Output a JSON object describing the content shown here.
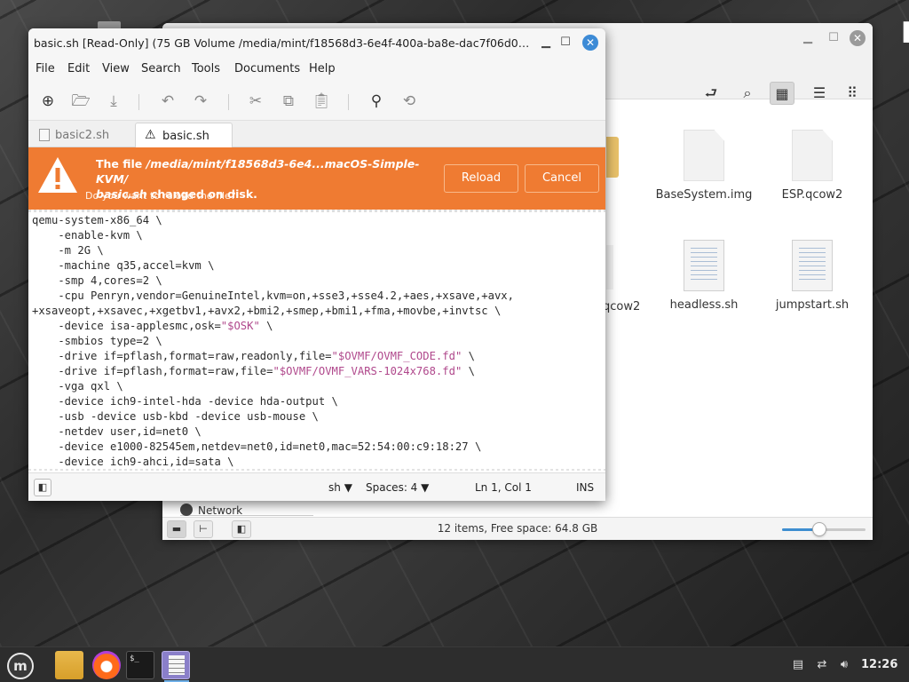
{
  "file_manager": {
    "files": [
      {
        "name": "BaseSystem.img",
        "kind": "blank"
      },
      {
        "name": "ESP.qcow2",
        "kind": "blank"
      },
      {
        "name": "headless.sh",
        "kind": "script"
      },
      {
        "name": "jumpstart.sh",
        "kind": "script"
      }
    ],
    "partial_file_name": "qcow2",
    "sidebar_network": "Network",
    "status_text": "12 items, Free space: 64.8 GB",
    "zoom_level": 0.45
  },
  "editor": {
    "window_title": "basic.sh [Read-Only] (75 GB Volume /media/mint/f18568d3-6e4f-400a-ba8e-dac7f06d017...",
    "menus": [
      "File",
      "Edit",
      "View",
      "Search",
      "Tools",
      "Documents",
      "Help"
    ],
    "tabs": [
      {
        "label": "basic2.sh",
        "active": false
      },
      {
        "label": "basic.sh",
        "active": true
      }
    ],
    "infobar": {
      "line_prefix": "The file ",
      "line_path": "/media/mint/f18568d3-6e4...macOS-Simple-KVM/",
      "line_file": "basic.sh",
      "line_suffix": " changed on disk.",
      "question": "Do you want to reload the file?",
      "reload_label": "Reload",
      "cancel_label": "Cancel",
      "color": "#ef7b32"
    },
    "code_lines": [
      "qemu-system-x86_64 \\",
      "    -enable-kvm \\",
      "    -m 2G \\",
      "    -machine q35,accel=kvm \\",
      "    -smp 4,cores=2 \\",
      "    -cpu Penryn,vendor=GenuineIntel,kvm=on,+sse3,+sse4.2,+aes,+xsave,+avx,",
      "+xsaveopt,+xsavec,+xgetbv1,+avx2,+bmi2,+smep,+bmi1,+fma,+movbe,+invtsc \\",
      "    -device isa-applesmc,osk=\"$OSK\" \\",
      "    -smbios type=2 \\",
      "    -drive if=pflash,format=raw,readonly,file=\"$OVMF/OVMF_CODE.fd\" \\",
      "    -drive if=pflash,format=raw,file=\"$OVMF/OVMF_VARS-1024x768.fd\" \\",
      "    -vga qxl \\",
      "    -device ich9-intel-hda -device hda-output \\",
      "    -usb -device usb-kbd -device usb-mouse \\",
      "    -netdev user,id=net0 \\",
      "    -device e1000-82545em,netdev=net0,id=net0,mac=52:54:00:c9:18:27 \\",
      "    -device ich9-ahci,id=sata \\"
    ],
    "status": {
      "language": "sh",
      "spaces": "Spaces: 4",
      "position": "Ln 1, Col 1",
      "mode": "INS"
    }
  },
  "taskbar": {
    "clock": "12:26",
    "terminal_prompt": "$_"
  }
}
